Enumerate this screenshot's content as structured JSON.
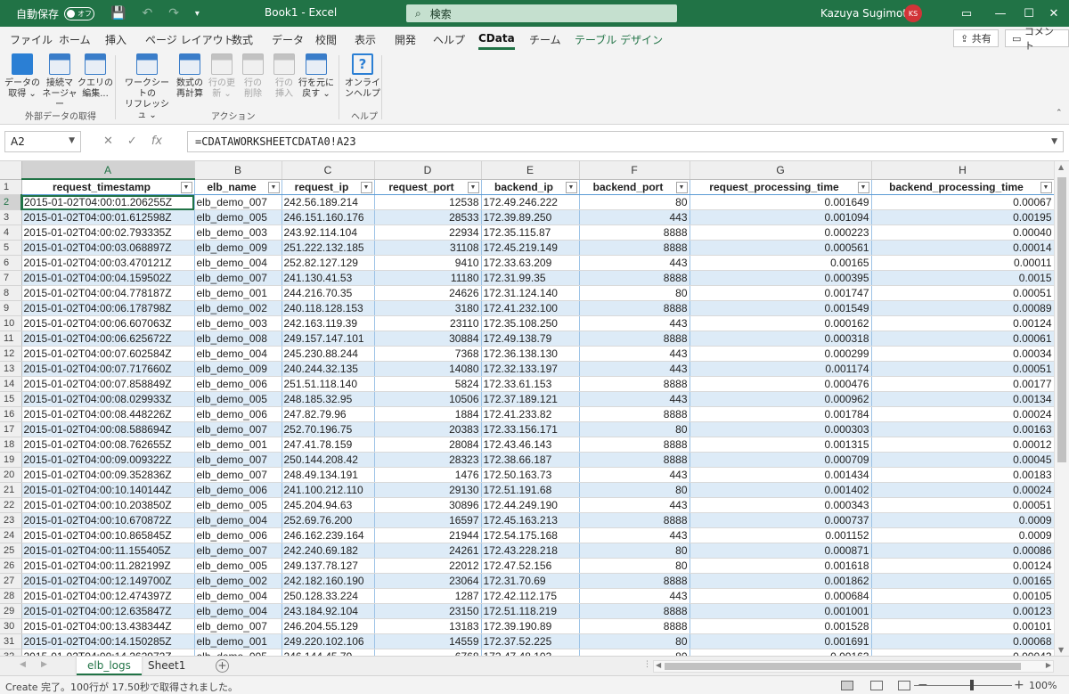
{
  "titlebar": {
    "autosave_label": "自動保存",
    "autosave_state": "オフ",
    "doc_title": "Book1  -  Excel",
    "search_placeholder": "検索",
    "user_name": "Kazuya Sugimoto",
    "user_initials": "KS"
  },
  "menu": {
    "tabs": [
      "ファイル",
      "ホーム",
      "挿入",
      "ページ レイアウト",
      "数式",
      "データ",
      "校閲",
      "表示",
      "開発",
      "ヘルプ",
      "CData",
      "チーム",
      "テーブル デザイン"
    ],
    "active_tab": "CData",
    "share": "共有",
    "comment": "コメント"
  },
  "ribbon": {
    "buttons": [
      {
        "l1": "データの",
        "l2": "取得 ⌄",
        "enabled": true
      },
      {
        "l1": "接続マ",
        "l2": "ネージャー",
        "enabled": true
      },
      {
        "l1": "クエリの",
        "l2": "編集...",
        "enabled": true
      },
      {
        "l1": "ワークシートの",
        "l2": "リフレッシュ ⌄",
        "enabled": true
      },
      {
        "l1": "数式の",
        "l2": "再計算",
        "enabled": true
      },
      {
        "l1": "行の更",
        "l2": "新 ⌄",
        "enabled": false
      },
      {
        "l1": "行の",
        "l2": "削除",
        "enabled": false
      },
      {
        "l1": "行の",
        "l2": "挿入",
        "enabled": false
      },
      {
        "l1": "行を元に",
        "l2": "戻す ⌄",
        "enabled": true
      },
      {
        "l1": "オンライ",
        "l2": "ンヘルプ",
        "enabled": true
      }
    ],
    "groups": [
      "外部データの取得",
      "アクション",
      "ヘルプ"
    ]
  },
  "formula_bar": {
    "name_box": "A2",
    "formula": "=CDATAWORKSHEETCDATA0!A23"
  },
  "sheet": {
    "columns": [
      "A",
      "B",
      "C",
      "D",
      "E",
      "F",
      "G",
      "H"
    ],
    "headers": [
      "request_timestamp",
      "elb_name",
      "request_ip",
      "request_port",
      "backend_ip",
      "backend_port",
      "request_processing_time",
      "backend_processing_time"
    ],
    "rows": [
      [
        "2015-01-02T04:00:01.206255Z",
        "elb_demo_007",
        "242.56.189.214",
        "12538",
        "172.49.246.222",
        "80",
        "0.001649",
        "0.00067"
      ],
      [
        "2015-01-02T04:00:01.612598Z",
        "elb_demo_005",
        "246.151.160.176",
        "28533",
        "172.39.89.250",
        "443",
        "0.001094",
        "0.00195"
      ],
      [
        "2015-01-02T04:00:02.793335Z",
        "elb_demo_003",
        "243.92.114.104",
        "22934",
        "172.35.115.87",
        "8888",
        "0.000223",
        "0.00040"
      ],
      [
        "2015-01-02T04:00:03.068897Z",
        "elb_demo_009",
        "251.222.132.185",
        "31108",
        "172.45.219.149",
        "8888",
        "0.000561",
        "0.00014"
      ],
      [
        "2015-01-02T04:00:03.470121Z",
        "elb_demo_004",
        "252.82.127.129",
        "9410",
        "172.33.63.209",
        "443",
        "0.00165",
        "0.00011"
      ],
      [
        "2015-01-02T04:00:04.159502Z",
        "elb_demo_007",
        "241.130.41.53",
        "11180",
        "172.31.99.35",
        "8888",
        "0.000395",
        "0.0015"
      ],
      [
        "2015-01-02T04:00:04.778187Z",
        "elb_demo_001",
        "244.216.70.35",
        "24626",
        "172.31.124.140",
        "80",
        "0.001747",
        "0.00051"
      ],
      [
        "2015-01-02T04:00:06.178798Z",
        "elb_demo_002",
        "240.118.128.153",
        "3180",
        "172.41.232.100",
        "8888",
        "0.001549",
        "0.00089"
      ],
      [
        "2015-01-02T04:00:06.607063Z",
        "elb_demo_003",
        "242.163.119.39",
        "23110",
        "172.35.108.250",
        "443",
        "0.000162",
        "0.00124"
      ],
      [
        "2015-01-02T04:00:06.625672Z",
        "elb_demo_008",
        "249.157.147.101",
        "30884",
        "172.49.138.79",
        "8888",
        "0.000318",
        "0.00061"
      ],
      [
        "2015-01-02T04:00:07.602584Z",
        "elb_demo_004",
        "245.230.88.244",
        "7368",
        "172.36.138.130",
        "443",
        "0.000299",
        "0.00034"
      ],
      [
        "2015-01-02T04:00:07.717660Z",
        "elb_demo_009",
        "240.244.32.135",
        "14080",
        "172.32.133.197",
        "443",
        "0.001174",
        "0.00051"
      ],
      [
        "2015-01-02T04:00:07.858849Z",
        "elb_demo_006",
        "251.51.118.140",
        "5824",
        "172.33.61.153",
        "8888",
        "0.000476",
        "0.00177"
      ],
      [
        "2015-01-02T04:00:08.029933Z",
        "elb_demo_005",
        "248.185.32.95",
        "10506",
        "172.37.189.121",
        "443",
        "0.000962",
        "0.00134"
      ],
      [
        "2015-01-02T04:00:08.448226Z",
        "elb_demo_006",
        "247.82.79.96",
        "1884",
        "172.41.233.82",
        "8888",
        "0.001784",
        "0.00024"
      ],
      [
        "2015-01-02T04:00:08.588694Z",
        "elb_demo_007",
        "252.70.196.75",
        "20383",
        "172.33.156.171",
        "80",
        "0.000303",
        "0.00163"
      ],
      [
        "2015-01-02T04:00:08.762655Z",
        "elb_demo_001",
        "247.41.78.159",
        "28084",
        "172.43.46.143",
        "8888",
        "0.001315",
        "0.00012"
      ],
      [
        "2015-01-02T04:00:09.009322Z",
        "elb_demo_007",
        "250.144.208.42",
        "28323",
        "172.38.66.187",
        "8888",
        "0.000709",
        "0.00045"
      ],
      [
        "2015-01-02T04:00:09.352836Z",
        "elb_demo_007",
        "248.49.134.191",
        "1476",
        "172.50.163.73",
        "443",
        "0.001434",
        "0.00183"
      ],
      [
        "2015-01-02T04:00:10.140144Z",
        "elb_demo_006",
        "241.100.212.110",
        "29130",
        "172.51.191.68",
        "80",
        "0.001402",
        "0.00024"
      ],
      [
        "2015-01-02T04:00:10.203850Z",
        "elb_demo_005",
        "245.204.94.63",
        "30896",
        "172.44.249.190",
        "443",
        "0.000343",
        "0.00051"
      ],
      [
        "2015-01-02T04:00:10.670872Z",
        "elb_demo_004",
        "252.69.76.200",
        "16597",
        "172.45.163.213",
        "8888",
        "0.000737",
        "0.0009"
      ],
      [
        "2015-01-02T04:00:10.865845Z",
        "elb_demo_006",
        "246.162.239.164",
        "21944",
        "172.54.175.168",
        "443",
        "0.001152",
        "0.0009"
      ],
      [
        "2015-01-02T04:00:11.155405Z",
        "elb_demo_007",
        "242.240.69.182",
        "24261",
        "172.43.228.218",
        "80",
        "0.000871",
        "0.00086"
      ],
      [
        "2015-01-02T04:00:11.282199Z",
        "elb_demo_005",
        "249.137.78.127",
        "22012",
        "172.47.52.156",
        "80",
        "0.001618",
        "0.00124"
      ],
      [
        "2015-01-02T04:00:12.149700Z",
        "elb_demo_002",
        "242.182.160.190",
        "23064",
        "172.31.70.69",
        "8888",
        "0.001862",
        "0.00165"
      ],
      [
        "2015-01-02T04:00:12.474397Z",
        "elb_demo_004",
        "250.128.33.224",
        "1287",
        "172.42.112.175",
        "443",
        "0.000684",
        "0.00105"
      ],
      [
        "2015-01-02T04:00:12.635847Z",
        "elb_demo_004",
        "243.184.92.104",
        "23150",
        "172.51.118.219",
        "8888",
        "0.001001",
        "0.00123"
      ],
      [
        "2015-01-02T04:00:13.438344Z",
        "elb_demo_007",
        "246.204.55.129",
        "13183",
        "172.39.190.89",
        "8888",
        "0.001528",
        "0.00101"
      ],
      [
        "2015-01-02T04:00:14.150285Z",
        "elb_demo_001",
        "249.220.102.106",
        "14559",
        "172.37.52.225",
        "80",
        "0.001691",
        "0.00068"
      ],
      [
        "2015-01-02T04:00:14.262972Z",
        "elb_demo_005",
        "246.144.45.79",
        "6768",
        "172.47.48.103",
        "80",
        "0.00163",
        "0.00043"
      ]
    ]
  },
  "sheet_tabs": [
    "elb_logs",
    "Sheet1"
  ],
  "active_sheet": "elb_logs",
  "status": {
    "message": "Create 完了。100行が 17.50秒で取得されました。",
    "zoom": "100%"
  },
  "colors": {
    "excel_green": "#217346",
    "band_blue": "#ddebf7",
    "grid_border": "#9dc3e6"
  }
}
